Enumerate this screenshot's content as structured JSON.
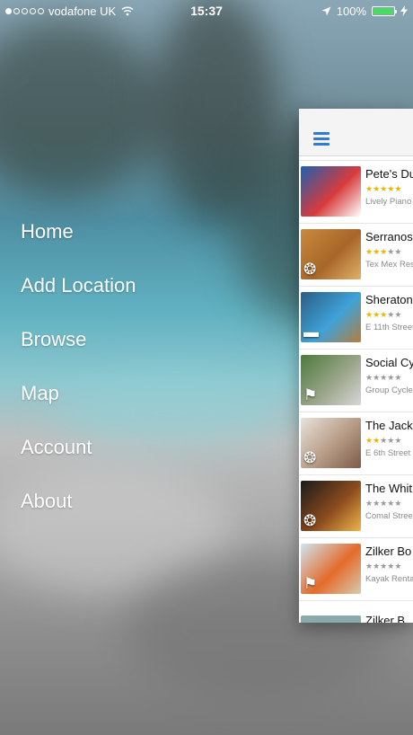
{
  "status_bar": {
    "carrier": "vodafone UK",
    "time": "15:37",
    "battery_percent": "100%",
    "signal_strength": 1,
    "battery_level": 1.0
  },
  "menu": {
    "items": [
      "Home",
      "Add Location",
      "Browse",
      "Map",
      "Account",
      "About"
    ]
  },
  "panel": {
    "listings": [
      {
        "name": "Pete's Du",
        "subtitle": "Lively Piano",
        "rating": 5,
        "icon": "none",
        "thumb_colors": [
          "#1f5fb0",
          "#d73b3b",
          "#ffffff"
        ]
      },
      {
        "name": "Serranos",
        "subtitle": "Tex Mex Res",
        "rating": 3,
        "icon": "fork-knife-icon",
        "thumb_colors": [
          "#c88a3f",
          "#a86628",
          "#e0b26b"
        ]
      },
      {
        "name": "Sheraton",
        "subtitle": "E 11th Street",
        "rating": 3,
        "icon": "bed-icon",
        "thumb_colors": [
          "#2b5d84",
          "#3fa2d8",
          "#b57d3c"
        ]
      },
      {
        "name": "Social Cy",
        "subtitle": "Group Cycle",
        "rating": 0,
        "icon": "hiker-icon",
        "thumb_colors": [
          "#4b7a3c",
          "#9aa58a",
          "#d7d7d7"
        ]
      },
      {
        "name": "The Jack",
        "subtitle": "E 6th Street",
        "rating": 2,
        "icon": "fork-knife-icon",
        "thumb_colors": [
          "#e8e2db",
          "#b69a84",
          "#7a5b4a"
        ]
      },
      {
        "name": "The Whit",
        "subtitle": "Comal Stree",
        "rating": 0,
        "icon": "fork-knife-icon",
        "thumb_colors": [
          "#1b1b1b",
          "#8a4a1d",
          "#f0b44a"
        ]
      },
      {
        "name": "Zilker Bo",
        "subtitle": "Kayak Renta",
        "rating": 0,
        "icon": "hiker-icon",
        "thumb_colors": [
          "#cfe6ee",
          "#e46b2a",
          "#d8cbb0"
        ]
      }
    ],
    "partial_bottom_name": "Zilker B"
  },
  "colors": {
    "accent": "#2f7ad6",
    "star_on": "#f0b400",
    "star_off": "#9a9a9a",
    "battery": "#4cd964"
  }
}
